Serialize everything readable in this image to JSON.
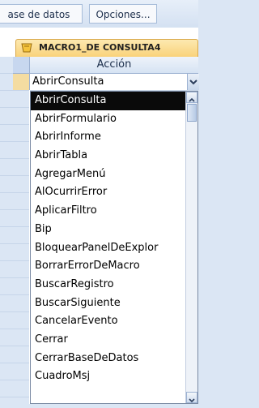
{
  "ribbon_tabs": [
    {
      "label": "ase de datos"
    },
    {
      "label": "Opciones..."
    }
  ],
  "document": {
    "title": "MACRO1_DE CONSULTA4"
  },
  "grid": {
    "column_header": "Acción",
    "current_value": "AbrirConsulta"
  },
  "dropdown": {
    "items": [
      "AbrirConsulta",
      "AbrirFormulario",
      "AbrirInforme",
      "AbrirTabla",
      "AgregarMenú",
      "AlOcurrirError",
      "AplicarFiltro",
      "Bip",
      "BloquearPanelDeExplor",
      "BorrarErrorDeMacro",
      "BuscarRegistro",
      "BuscarSiguiente",
      "CancelarEvento",
      "Cerrar",
      "CerrarBaseDeDatos",
      "CuadroMsj"
    ],
    "selected_index": 0
  },
  "icons": {
    "doc_icon": "macro-icon",
    "combo_arrow": "chevron-down-icon",
    "scroll_up": "chevron-up-icon",
    "scroll_down": "chevron-down-icon"
  }
}
